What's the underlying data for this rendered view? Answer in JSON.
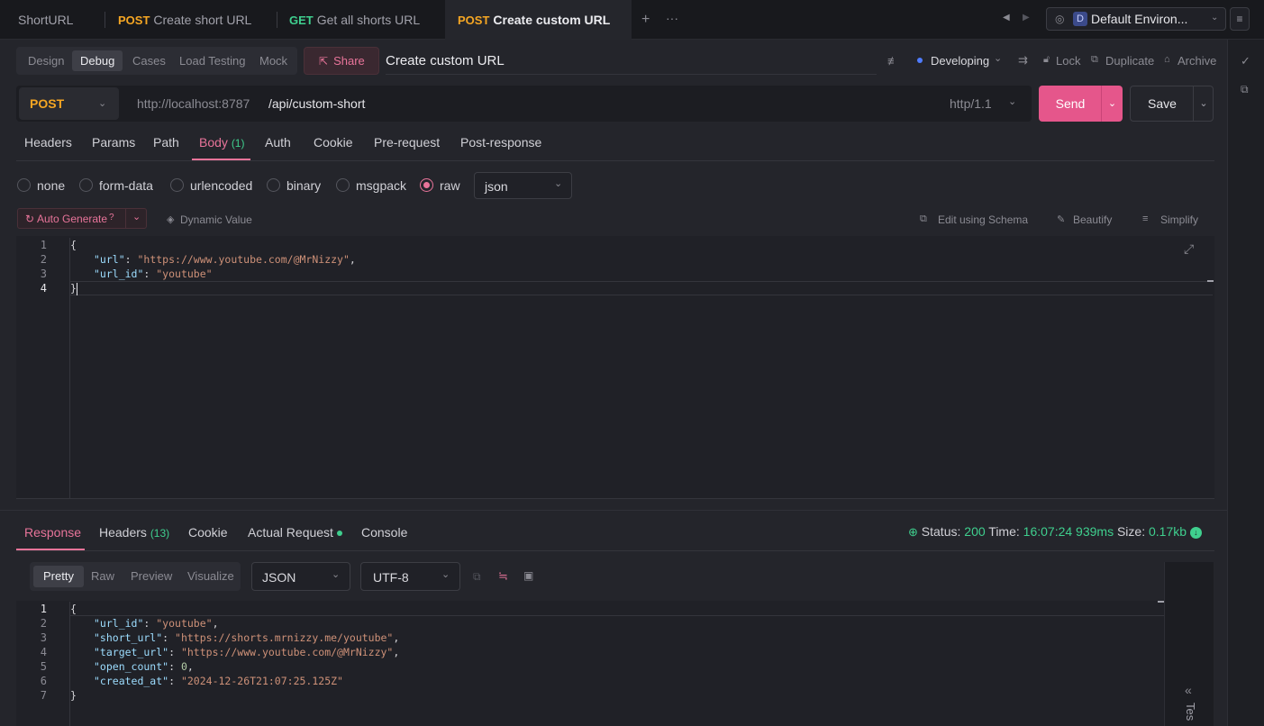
{
  "tabs": [
    {
      "method": "",
      "label": "ShortURL"
    },
    {
      "method": "POST",
      "label": "Create short URL"
    },
    {
      "method": "GET",
      "label": "Get all shorts URL"
    },
    {
      "method": "POST",
      "label": "Create custom URL"
    }
  ],
  "environment": {
    "badge": "D",
    "label": "Default Environ..."
  },
  "modes": [
    "Design",
    "Debug",
    "Cases",
    "Load Testing",
    "Mock"
  ],
  "share_label": "Share",
  "endpoint_name": "Create custom URL",
  "status_label": "Developing",
  "actions": {
    "lock": "Lock",
    "duplicate": "Duplicate",
    "archive": "Archive"
  },
  "request": {
    "method": "POST",
    "base_url": "http://localhost:8787",
    "path": "/api/custom-short",
    "http_version": "http/1.1",
    "send_label": "Send",
    "save_label": "Save"
  },
  "request_tabs": {
    "headers": "Headers",
    "params": "Params",
    "path": "Path",
    "body": "Body",
    "body_count": "(1)",
    "auth": "Auth",
    "cookie": "Cookie",
    "prerequest": "Pre-request",
    "postresponse": "Post-response"
  },
  "body_types": [
    "none",
    "form-data",
    "urlencoded",
    "binary",
    "msgpack",
    "raw"
  ],
  "body_format": "json",
  "tools": {
    "auto_generate": "Auto Generate",
    "dynamic_value": "Dynamic Value",
    "edit_schema": "Edit using Schema",
    "beautify": "Beautify",
    "simplify": "Simplify"
  },
  "request_body": {
    "line_numbers": [
      "1",
      "2",
      "3",
      "4"
    ],
    "url_key": "\"url\"",
    "url_value": "\"https://www.youtube.com/@MrNizzy\"",
    "url_id_key": "\"url_id\"",
    "url_id_value": "\"youtube\""
  },
  "response_tabs": {
    "response": "Response",
    "headers": "Headers",
    "headers_count": "(13)",
    "cookie": "Cookie",
    "actual_request": "Actual Request",
    "console": "Console"
  },
  "response_meta": {
    "status_label": "Status:",
    "status": "200",
    "time_label": "Time:",
    "time": "16:07:24",
    "duration": "939ms",
    "size_label": "Size:",
    "size": "0.17kb"
  },
  "view_modes": [
    "Pretty",
    "Raw",
    "Preview",
    "Visualize"
  ],
  "response_format": "JSON",
  "response_encoding": "UTF-8",
  "response_body": {
    "line_numbers": [
      "1",
      "2",
      "3",
      "4",
      "5",
      "6",
      "7"
    ],
    "url_id_key": "\"url_id\"",
    "url_id_value": "\"youtube\"",
    "short_url_key": "\"short_url\"",
    "short_url_value": "\"https://shorts.mrnizzy.me/youtube\"",
    "target_url_key": "\"target_url\"",
    "target_url_value": "\"https://www.youtube.com/@MrNizzy\"",
    "open_count_key": "\"open_count\"",
    "open_count_value": "0",
    "created_at_key": "\"created_at\"",
    "created_at_value": "\"2024-12-26T21:07:25.125Z\""
  },
  "side_panel_label": "Tes",
  "colors": {
    "accent": "#e8749a",
    "post": "#f5a623",
    "get": "#3fcf8e",
    "success": "#3fcf8e"
  }
}
